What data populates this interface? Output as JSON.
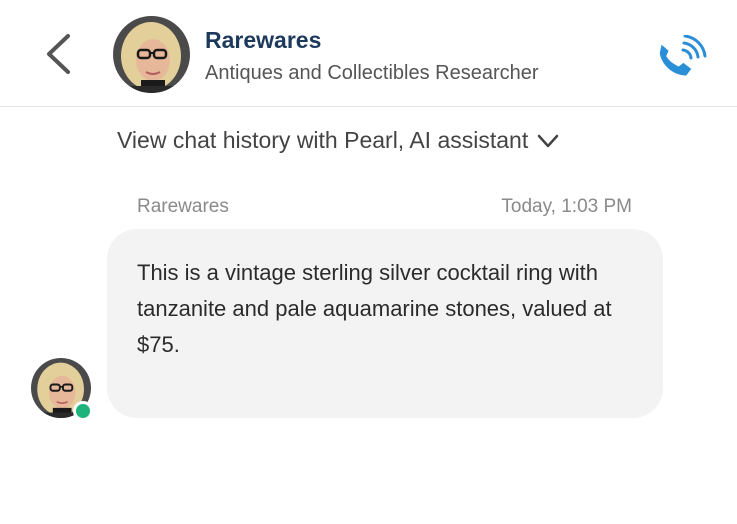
{
  "header": {
    "name": "Rarewares",
    "subtitle": "Antiques and Collectibles Researcher",
    "back_icon": "chevron-left-icon",
    "call_icon": "phone-ringing-icon",
    "accent_color": "#2a8fd6"
  },
  "history": {
    "label": "View chat history with Pearl, AI assistant",
    "icon": "chevron-down-icon"
  },
  "message": {
    "sender": "Rarewares",
    "timestamp": "Today, 1:03 PM",
    "text": "This is a vintage sterling silver cocktail ring with tanzanite and pale aquamarine stones, valued at $75.",
    "online_color": "#1db37a"
  }
}
